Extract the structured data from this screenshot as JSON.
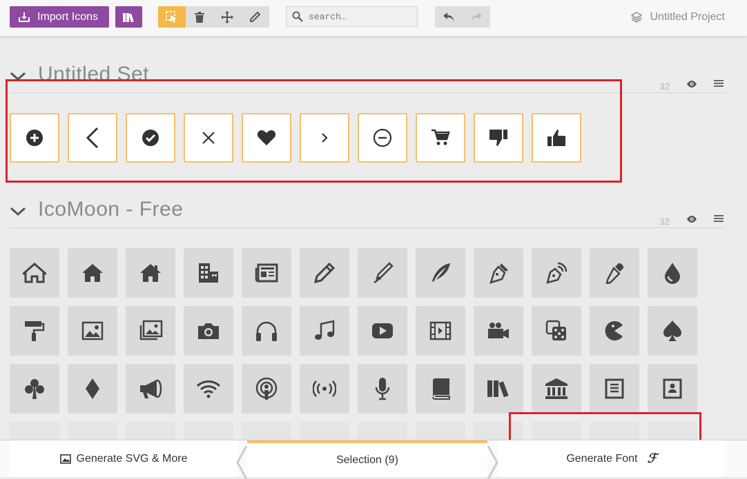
{
  "toolbar": {
    "import_label": "Import Icons",
    "search_placeholder": "search…",
    "project_name": "Untitled Project",
    "accent_color": "#f5b64a",
    "brand_color": "#8e4aa0"
  },
  "sets": [
    {
      "title": "Untitled Set",
      "count": "32",
      "icons": [
        "plus-circle-icon",
        "chevron-left-icon",
        "check-circle-icon",
        "close-icon",
        "heart-icon",
        "chevron-right-icon",
        "minus-circle-icon",
        "cart-icon",
        "thumbs-down-icon",
        "thumbs-up-icon"
      ]
    },
    {
      "title": "IcoMoon - Free",
      "count": "32",
      "icons": [
        "home-icon",
        "home2-icon",
        "home3-icon",
        "office-icon",
        "newspaper-icon",
        "pencil-icon",
        "pencil2-icon",
        "quill-icon",
        "pen-icon",
        "blog-icon",
        "eyedropper-icon",
        "droplet-icon",
        "paint-format-icon",
        "image-icon",
        "images-icon",
        "camera-icon",
        "headphones-icon",
        "music-icon",
        "play-icon",
        "film-icon",
        "video-camera-icon",
        "dice-icon",
        "pacman-icon",
        "spades-icon",
        "clubs-icon",
        "diamonds-icon",
        "bullhorn-icon",
        "connection-icon",
        "podcast-icon",
        "feed-icon",
        "mic-icon",
        "book-icon",
        "books-icon",
        "library-icon",
        "file-text-icon",
        "profile-icon"
      ]
    }
  ],
  "bottom": {
    "generate_svg_label": "Generate SVG & More",
    "selection_label": "Selection (9)",
    "generate_font_label": "Generate Font"
  }
}
